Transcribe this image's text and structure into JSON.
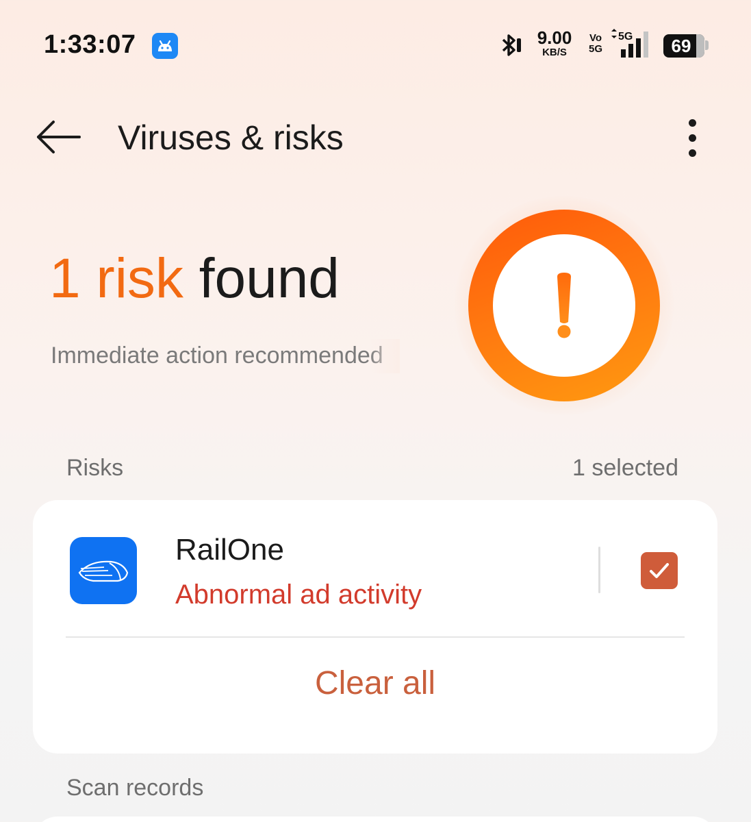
{
  "status_bar": {
    "time": "1:33:07",
    "net_speed": "9.00",
    "net_speed_unit": "KB/S",
    "volte_top": "Vo",
    "volte_bottom": "5G",
    "network_type": "5G",
    "battery_level": "69",
    "icons": [
      "android-notification-icon",
      "bluetooth-icon",
      "data-arrows-icon",
      "signal-bars-icon",
      "battery-icon"
    ]
  },
  "app_bar": {
    "title": "Viruses & risks",
    "back_icon": "back-arrow-icon",
    "more_icon": "more-vert-icon"
  },
  "summary": {
    "risk_count_text": "1 risk",
    "found_text": " found",
    "subtitle": "Immediate action recommended",
    "warning_icon": "exclamation-icon"
  },
  "risks_section": {
    "label": "Risks",
    "selected_text": "1 selected",
    "items": [
      {
        "app_name": "RailOne",
        "description": "Abnormal ad activity",
        "checked": true,
        "icon": "railone-train-icon"
      }
    ],
    "clear_all_label": "Clear all"
  },
  "scan_records": {
    "label": "Scan records"
  },
  "colors": {
    "accent_orange": "#f26a12",
    "danger_text": "#d23b2c",
    "checkbox": "#cf5c3a",
    "clear_all": "#c9603d",
    "app_icon_bg": "#0f72f2"
  }
}
